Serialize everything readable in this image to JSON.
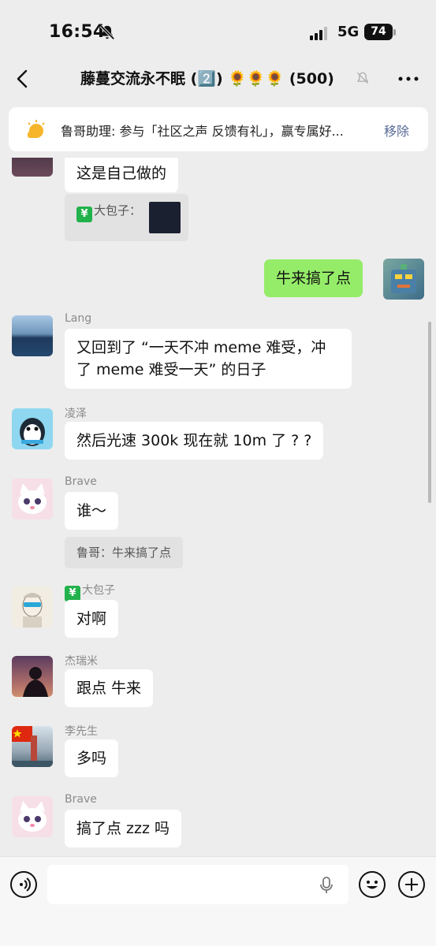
{
  "status_bar": {
    "time": "16:54",
    "network": "5G",
    "battery": "74"
  },
  "header": {
    "title": "藤蔓交流永不眠 (2️⃣) 🌻🌻🌻 (500)"
  },
  "notice": {
    "text": "鲁哥助理: 参与「社区之声 反馈有礼」，赢专属好...",
    "action": "移除"
  },
  "messages": [
    {
      "sender": "",
      "text": "这是自己做的",
      "type": "text"
    },
    {
      "sender": "",
      "quote_text": "大包子：",
      "type": "quote-image"
    },
    {
      "sender": "me",
      "text": "牛来搞了点",
      "type": "text"
    },
    {
      "sender": "Lang",
      "text": "又回到了 “一天不冲 meme 难受，冲了 meme 难受一天” 的日子",
      "type": "text"
    },
    {
      "sender": "凌泽",
      "text": "然后光速 300k 现在就 10m 了 ? ?",
      "type": "text"
    },
    {
      "sender": "Brave",
      "text": "谁～",
      "quote": "鲁哥：牛来搞了点",
      "type": "text"
    },
    {
      "sender": "大包子",
      "text": "对啊",
      "type": "text"
    },
    {
      "sender": "杰瑞米",
      "text": "跟点 牛来",
      "type": "text"
    },
    {
      "sender": "李先生",
      "text": "多吗",
      "type": "text"
    },
    {
      "sender": "Brave",
      "text": "搞了点 zzz 吗",
      "type": "text"
    }
  ],
  "badge_glyph": "¥",
  "colors": {
    "accent_link": "#576b95",
    "my_bubble": "#95ec69",
    "background": "#ededed"
  },
  "icons": [
    "bell-off-icon",
    "back-icon",
    "more-icon",
    "bulb-icon",
    "voice-icon",
    "mic-icon",
    "emoji-icon",
    "plus-icon"
  ]
}
